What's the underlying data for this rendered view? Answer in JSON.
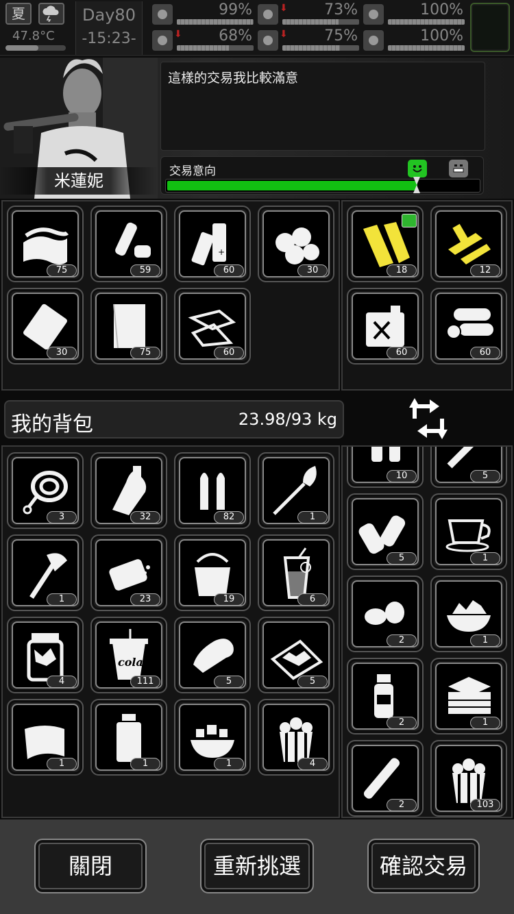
{
  "status": {
    "season": "夏",
    "temperature": "47.8°C",
    "temperature_level": 0.55,
    "day": "Day80",
    "time": "-15:23-",
    "stats": [
      {
        "name": "health",
        "icon": "medkit-icon",
        "value": "99%",
        "level": 0.99,
        "down": false
      },
      {
        "name": "hunger",
        "icon": "stomach-icon",
        "value": "73%",
        "level": 0.73,
        "down": true
      },
      {
        "name": "sanity",
        "icon": "brain-icon",
        "value": "100%",
        "level": 1.0,
        "down": false
      },
      {
        "name": "stamina",
        "icon": "boot-icon",
        "value": "68%",
        "level": 0.68,
        "down": true
      },
      {
        "name": "thirst",
        "icon": "water-drop-icon",
        "value": "75%",
        "level": 0.75,
        "down": true
      },
      {
        "name": "mood",
        "icon": "heart-icon",
        "value": "100%",
        "level": 1.0,
        "down": false
      }
    ]
  },
  "trader": {
    "name": "米蓮妮",
    "dialog": "這樣的交易我比較滿意",
    "intent_label": "交易意向",
    "intent_level": 0.8
  },
  "trader_inventory": [
    {
      "icon": "cloth-icon",
      "count": "75"
    },
    {
      "icon": "plastic-bottle-icon",
      "count": "59"
    },
    {
      "icon": "battery-icon",
      "count": "60"
    },
    {
      "icon": "cotton-icon",
      "count": "30"
    },
    {
      "icon": "plastic-sheet-icon",
      "count": "30"
    },
    {
      "icon": "paper-sheet-icon",
      "count": "75"
    },
    {
      "icon": "scrap-paper-icon",
      "count": "60"
    }
  ],
  "trader_offer": [
    {
      "icon": "wood-plank-icon",
      "count": "18",
      "highlight": true,
      "badge": true
    },
    {
      "icon": "gold-parts-icon",
      "count": "12",
      "highlight": true
    },
    {
      "icon": "fuel-can-icon",
      "count": "60"
    },
    {
      "icon": "logs-icon",
      "count": "60"
    }
  ],
  "backpack": {
    "title": "我的背包",
    "weight": "23.98/93 kg"
  },
  "my_inventory": [
    {
      "icon": "rope-icon",
      "count": "3"
    },
    {
      "icon": "glass-bottle-icon",
      "count": "32"
    },
    {
      "icon": "bullets-icon",
      "count": "82"
    },
    {
      "icon": "shovel-icon",
      "count": "1"
    },
    {
      "icon": "axe-icon",
      "count": "1"
    },
    {
      "icon": "soap-icon",
      "count": "23"
    },
    {
      "icon": "bucket-icon",
      "count": "19"
    },
    {
      "icon": "juice-icon",
      "count": "6"
    },
    {
      "icon": "pickle-jar-icon",
      "count": "4"
    },
    {
      "icon": "cola-cup-icon",
      "count": "111",
      "label": "cola"
    },
    {
      "icon": "bandage-icon",
      "count": "5"
    },
    {
      "icon": "tray-food-icon",
      "count": "5"
    },
    {
      "icon": "fabric-scrap-icon",
      "count": "1"
    },
    {
      "icon": "jar-icon",
      "count": "1"
    },
    {
      "icon": "salad-bowl-icon",
      "count": "1"
    },
    {
      "icon": "popcorn-icon",
      "count": "4"
    }
  ],
  "my_offer": [
    {
      "icon": "bottles-icon",
      "count": "10"
    },
    {
      "icon": "syringe-icon",
      "count": "5"
    },
    {
      "icon": "paper-roll-icon",
      "count": "5"
    },
    {
      "icon": "coffee-cup-icon",
      "count": "1"
    },
    {
      "icon": "nuts-icon",
      "count": "2"
    },
    {
      "icon": "fruit-bowl-icon",
      "count": "1"
    },
    {
      "icon": "spray-bottle-icon",
      "count": "2"
    },
    {
      "icon": "sandwich-icon",
      "count": "1"
    },
    {
      "icon": "tube-icon",
      "count": "2"
    },
    {
      "icon": "popcorn-icon",
      "count": "103"
    }
  ],
  "buttons": {
    "close": "關閉",
    "reselect": "重新挑選",
    "confirm": "確認交易"
  },
  "colors": {
    "intent_green": "#12c012",
    "highlight_yellow": "#f2e33a"
  }
}
